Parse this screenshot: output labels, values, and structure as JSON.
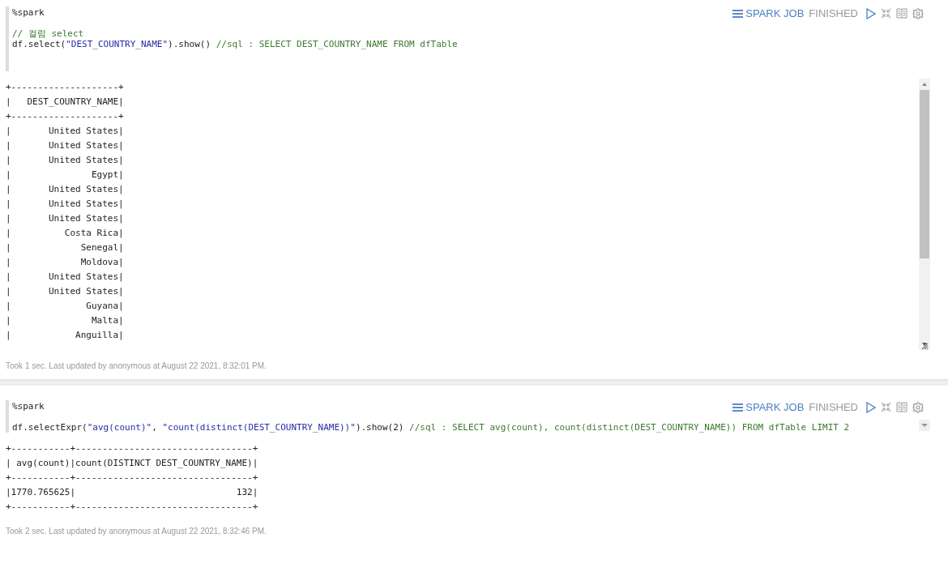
{
  "paragraphs": [
    {
      "interpreter": "%spark",
      "job_label": "SPARK JOB",
      "status": "FINISHED",
      "editor_scrollbar": false,
      "output_scrollbar": true,
      "code_lines": [
        [
          {
            "kind": "comment",
            "text": "// 컬럼 select"
          }
        ],
        [
          {
            "kind": "plain",
            "text": "df.select("
          },
          {
            "kind": "string",
            "text": "\"DEST_COUNTRY_NAME\""
          },
          {
            "kind": "plain",
            "text": ").show() "
          },
          {
            "kind": "comment",
            "text": "//sql : SELECT DEST_COUNTRY_NAME FROM dfTable"
          }
        ]
      ],
      "output_lines": [
        "+--------------------+",
        "|   DEST_COUNTRY_NAME|",
        "+--------------------+",
        "|       United States|",
        "|       United States|",
        "|       United States|",
        "|               Egypt|",
        "|       United States|",
        "|       United States|",
        "|       United States|",
        "|          Costa Rica|",
        "|             Senegal|",
        "|             Moldova|",
        "|       United States|",
        "|       United States|",
        "|              Guyana|",
        "|               Malta|",
        "|            Anguilla|"
      ],
      "footer": "Took 1 sec. Last updated by anonymous at August 22 2021, 8:32:01 PM."
    },
    {
      "interpreter": "%spark",
      "job_label": "SPARK JOB",
      "status": "FINISHED",
      "editor_scrollbar": true,
      "output_scrollbar": false,
      "code_lines": [
        [
          {
            "kind": "plain",
            "text": "df.selectExpr("
          },
          {
            "kind": "string",
            "text": "\"avg(count)\""
          },
          {
            "kind": "plain",
            "text": ", "
          },
          {
            "kind": "string",
            "text": "\"count(distinct(DEST_COUNTRY_NAME))\""
          },
          {
            "kind": "plain",
            "text": ").show(2) "
          },
          {
            "kind": "comment",
            "text": "//sql : SELECT avg(count), count(distinct(DEST_COUNTRY_NAME)) FROM dfTable LIMIT 2"
          }
        ]
      ],
      "output_lines": [
        "+-----------+---------------------------------+",
        "| avg(count)|count(DISTINCT DEST_COUNTRY_NAME)|",
        "+-----------+---------------------------------+",
        "|1770.765625|                              132|",
        "+-----------+---------------------------------+"
      ],
      "footer": "Took 2 sec. Last updated by anonymous at August 22 2021, 8:32:46 PM."
    }
  ]
}
